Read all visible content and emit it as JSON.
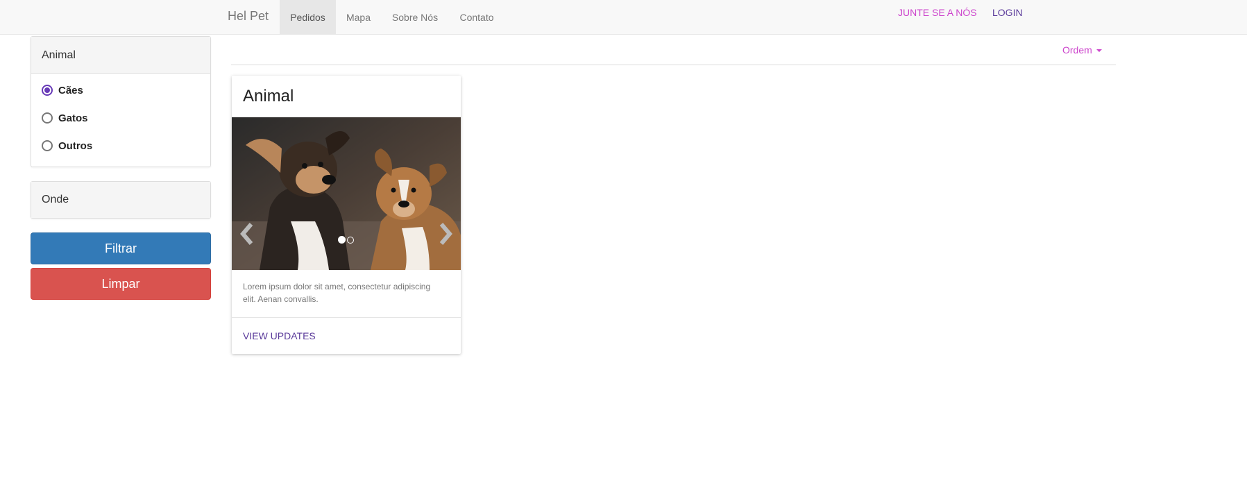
{
  "navbar": {
    "brand": "Hel Pet",
    "items": [
      {
        "label": "Pedidos",
        "active": true
      },
      {
        "label": "Mapa",
        "active": false
      },
      {
        "label": "Sobre Nós",
        "active": false
      },
      {
        "label": "Contato",
        "active": false
      }
    ],
    "join_label": "JUNTE SE A NÓS",
    "login_label": "LOGIN"
  },
  "filters": {
    "animal": {
      "heading": "Animal",
      "options": [
        {
          "label": "Cães",
          "checked": true
        },
        {
          "label": "Gatos",
          "checked": false
        },
        {
          "label": "Outros",
          "checked": false
        }
      ]
    },
    "onde": {
      "heading": "Onde"
    },
    "filter_button": "Filtrar",
    "clear_button": "Limpar"
  },
  "ordering": {
    "label": "Ordem"
  },
  "card": {
    "title": "Animal",
    "image_alt": "two puppies",
    "text": "Lorem ipsum dolor sit amet, consectetur adipiscing elit. Aenan convallis.",
    "action": "VIEW UPDATES",
    "carousel": {
      "slides": 2,
      "active_slide": 1
    }
  },
  "colors": {
    "accent_purple": "#673ab7",
    "link_magenta": "#cc44cc",
    "primary": "#337ab7",
    "danger": "#d9534f"
  }
}
